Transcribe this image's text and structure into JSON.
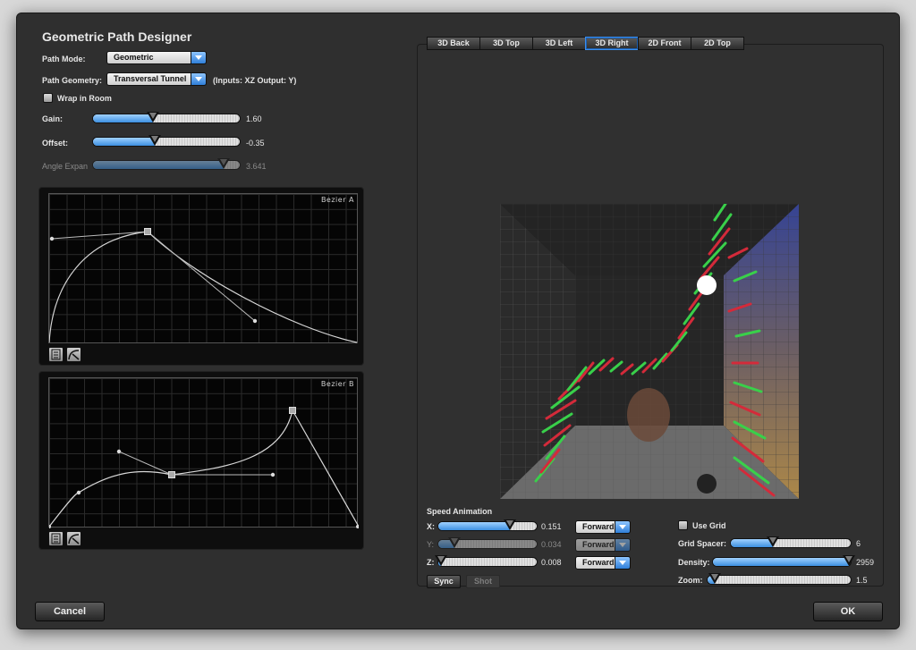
{
  "app": {
    "title": "Geometric Path Designer"
  },
  "path_mode": {
    "label": "Path Mode:",
    "value": "Geometric"
  },
  "path_geometry": {
    "label": "Path Geometry:",
    "value": "Transversal Tunnel",
    "note": "(Inputs: XZ Output: Y)"
  },
  "wrap_in_room": {
    "label": "Wrap in Room",
    "checked": false
  },
  "gain": {
    "label": "Gain:",
    "value": "1.60",
    "fraction": 0.41
  },
  "offset": {
    "label": "Offset:",
    "value": "-0.35",
    "fraction": 0.42
  },
  "angle_expansion": {
    "label": "Angle Expan",
    "value": "3.641",
    "fraction": 0.89
  },
  "bezier_a": {
    "name": "Bezier A"
  },
  "bezier_b": {
    "name": "Bezier B"
  },
  "tabs": [
    {
      "label": "3D Back",
      "active": false
    },
    {
      "label": "3D Top",
      "active": false
    },
    {
      "label": "3D Left",
      "active": false
    },
    {
      "label": "3D Right",
      "active": true
    },
    {
      "label": "2D Front",
      "active": false
    },
    {
      "label": "2D Top",
      "active": false
    }
  ],
  "speed_animation": {
    "title": "Speed Animation",
    "rows": [
      {
        "axis": "X:",
        "value": "0.151",
        "fraction": 0.73,
        "direction": "Forward",
        "enabled": true
      },
      {
        "axis": "Y:",
        "value": "0.034",
        "fraction": 0.16,
        "direction": "Forward",
        "enabled": false
      },
      {
        "axis": "Z:",
        "value": "0.008",
        "fraction": 0.03,
        "direction": "Forward",
        "enabled": true
      }
    ],
    "sync_label": "Sync",
    "shot_label": "Shot"
  },
  "grid": {
    "use_grid_label": "Use Grid",
    "use_grid_checked": false,
    "spacer": {
      "label": "Grid Spacer:",
      "value": "6",
      "fraction": 0.35
    },
    "density": {
      "label": "Density:",
      "value": "2959",
      "fraction": 0.99
    },
    "zoom": {
      "label": "Zoom:",
      "value": "1.5",
      "fraction": 0.05
    }
  },
  "buttons": {
    "cancel": "Cancel",
    "ok": "OK"
  },
  "colors": {
    "accent": "#3c8fe0",
    "path_green": "#39d04a",
    "path_red": "#d42a3a"
  }
}
